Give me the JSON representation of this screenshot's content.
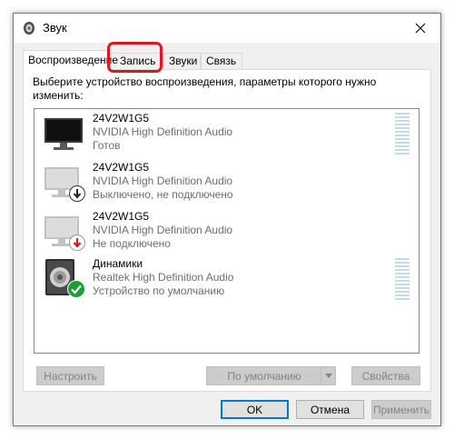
{
  "window": {
    "title": "Звук",
    "close_icon": "close-icon"
  },
  "tabs": [
    {
      "label": "Воспроизведение",
      "active": true
    },
    {
      "label": "Запись",
      "active": false
    },
    {
      "label": "Звуки",
      "active": false
    },
    {
      "label": "Связь",
      "active": false
    }
  ],
  "playback": {
    "instruction": "Выберите устройство воспроизведения, параметры которого нужно изменить:",
    "devices": [
      {
        "name": "24V2W1G5",
        "driver": "NVIDIA High Definition Audio",
        "status": "Готов",
        "icon": "monitor-icon",
        "badge": "",
        "level_meter": true
      },
      {
        "name": "24V2W1G5",
        "driver": "NVIDIA High Definition Audio",
        "status": "Выключено, не подключено",
        "icon": "monitor-disabled-icon",
        "badge": "down-arrow-badge-icon",
        "level_meter": false
      },
      {
        "name": "24V2W1G5",
        "driver": "NVIDIA High Definition Audio",
        "status": "Не подключено",
        "icon": "monitor-disconnected-icon",
        "badge": "red-down-arrow-badge-icon",
        "level_meter": false
      },
      {
        "name": "Динамики",
        "driver": "Realtek High Definition Audio",
        "status": "Устройство по умолчанию",
        "icon": "speaker-icon",
        "badge": "green-check-badge-icon",
        "level_meter": true
      }
    ],
    "configure_label": "Настроить",
    "set_default_label": "По умолчанию",
    "properties_label": "Свойства"
  },
  "footer": {
    "ok_label": "OK",
    "cancel_label": "Отмена",
    "apply_label": "Применить"
  },
  "colors": {
    "highlight": "#e0171f",
    "accent": "#0078d7",
    "check_green": "#1e9e3a",
    "arrow_red": "#d21d1d"
  }
}
